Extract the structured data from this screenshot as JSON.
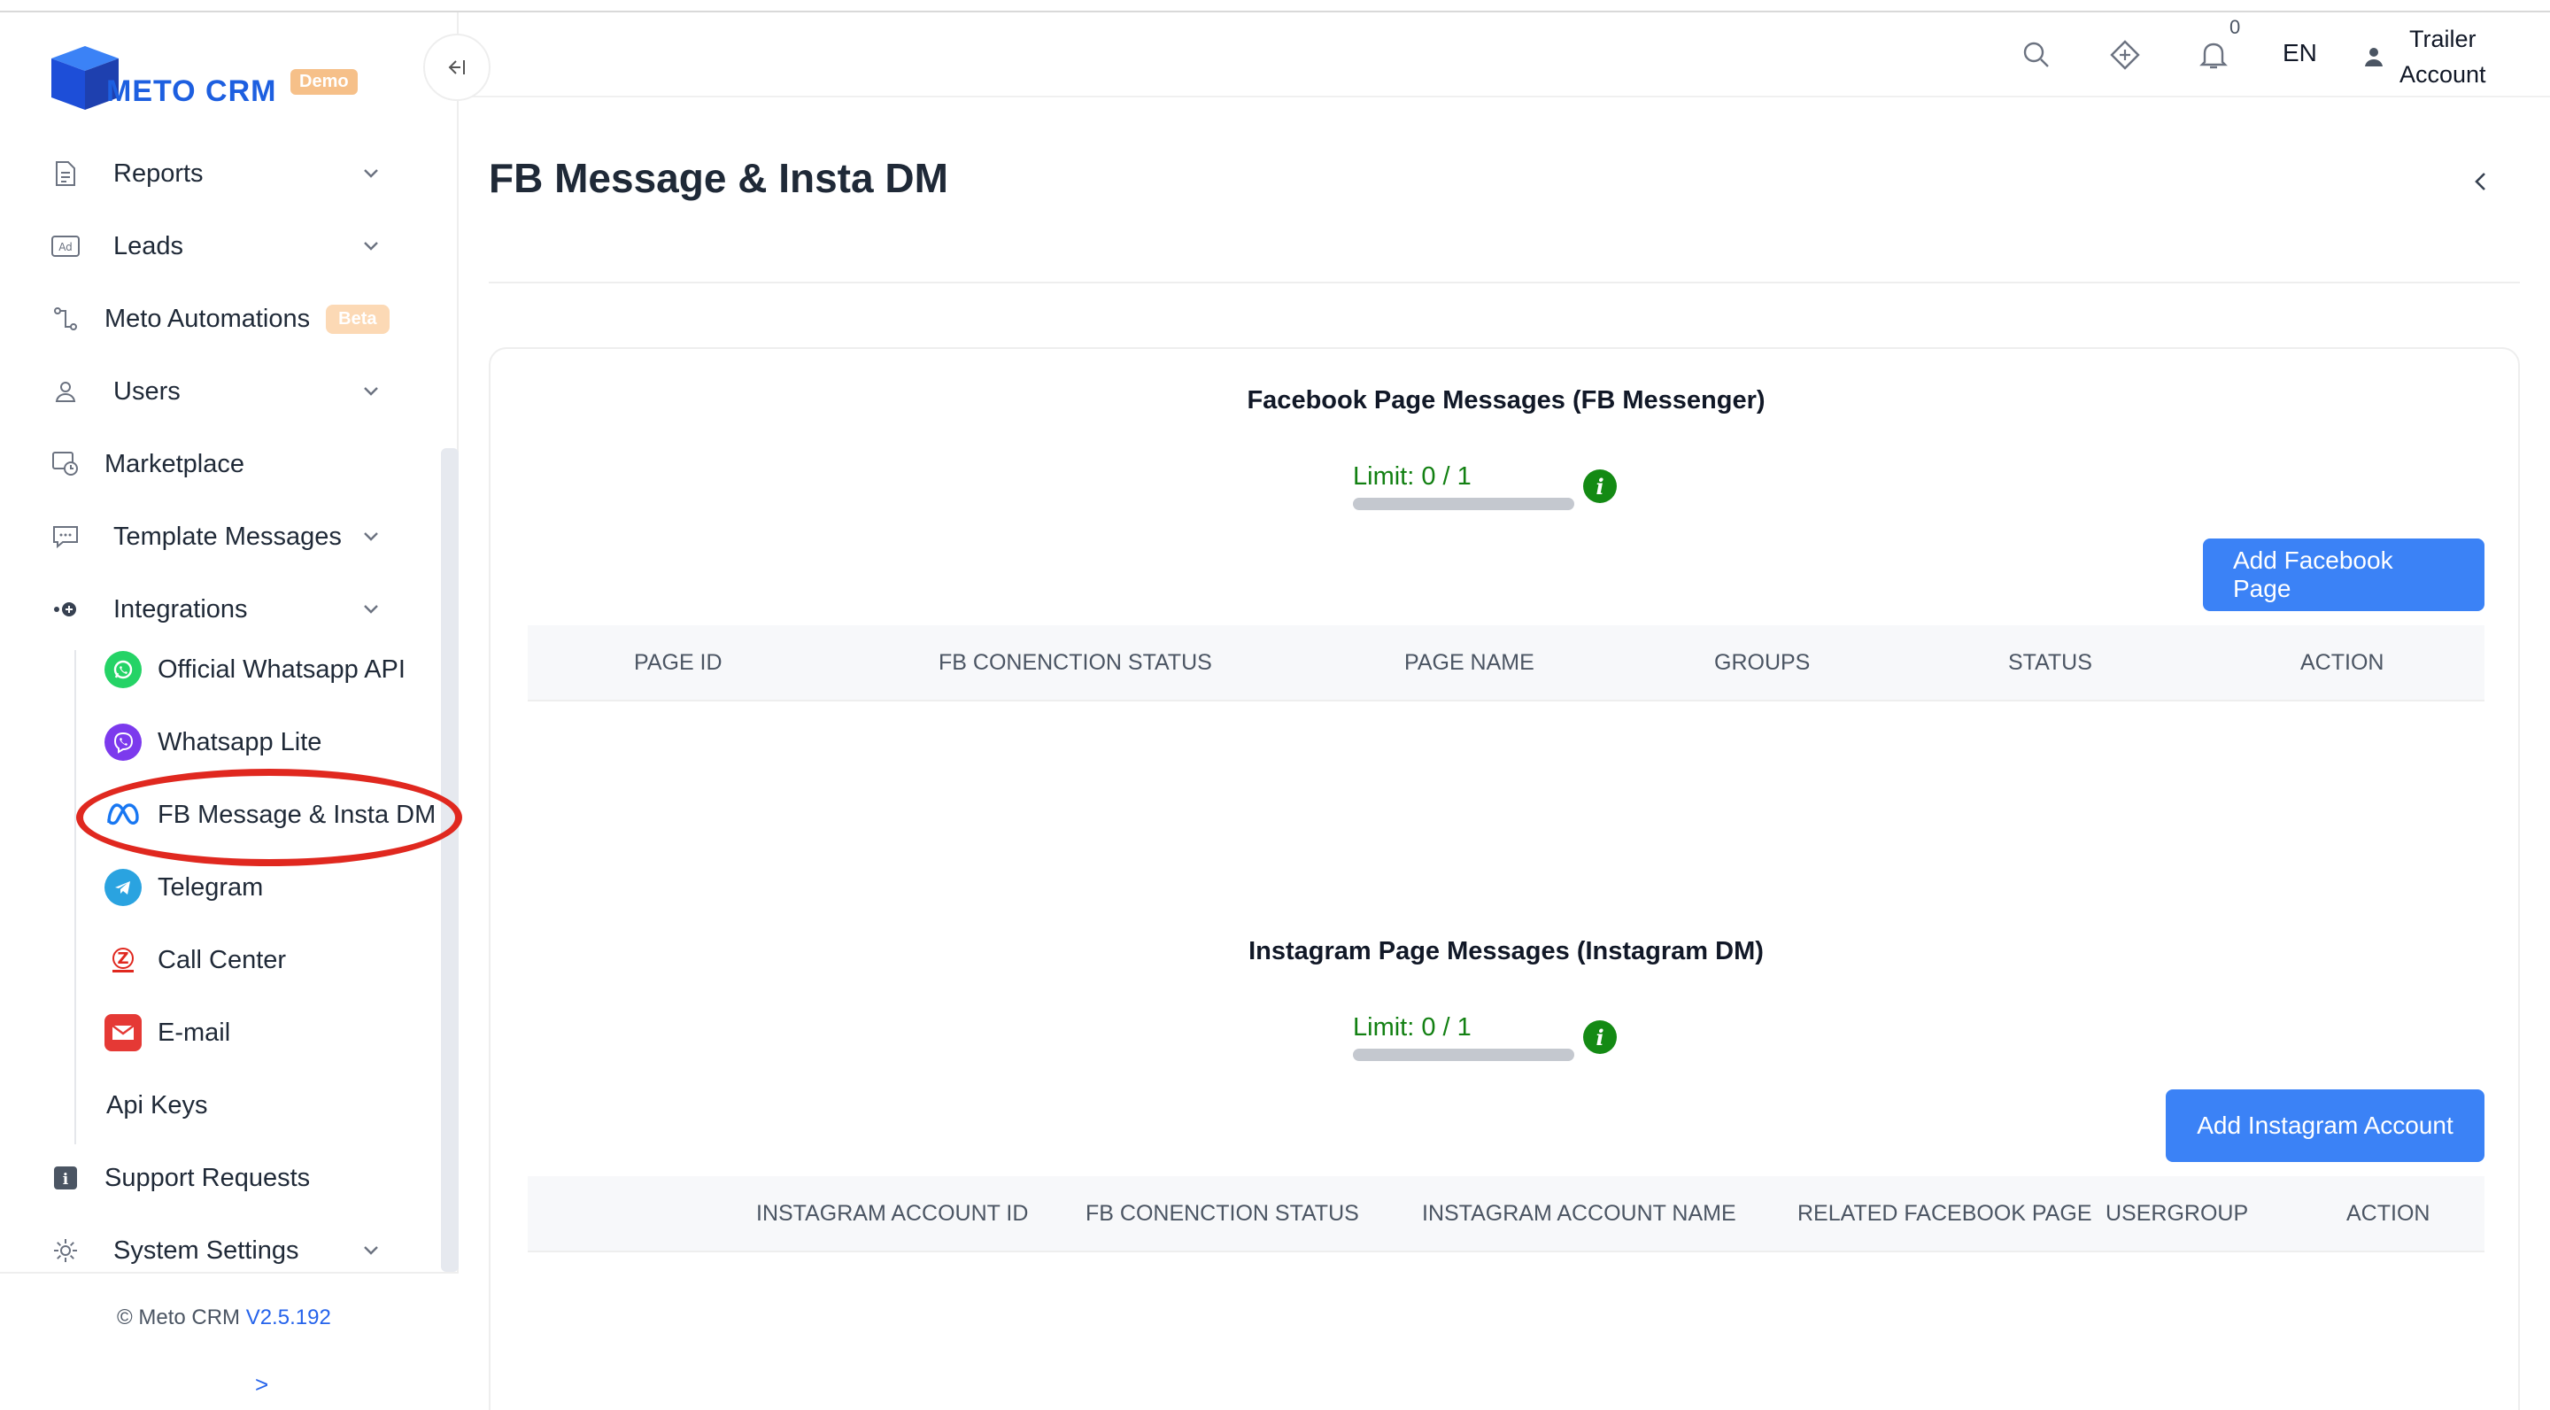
{
  "brand": {
    "name": "METO CRM",
    "badge": "Demo",
    "accent": "#1d5fe0"
  },
  "sidebar": {
    "items": [
      {
        "label": "Reports",
        "icon": "document-icon",
        "has_chevron": true
      },
      {
        "label": "Leads",
        "icon": "ad-icon",
        "has_chevron": true
      },
      {
        "label": "Meto Automations",
        "icon": "automation-icon",
        "badge": "Beta"
      },
      {
        "label": "Users",
        "icon": "user-icon",
        "has_chevron": true
      },
      {
        "label": "Marketplace",
        "icon": "marketplace-icon"
      },
      {
        "label": "Template Messages",
        "icon": "message-icon",
        "has_chevron": true
      },
      {
        "label": "Integrations",
        "icon": "integration-icon",
        "has_chevron": true,
        "expanded": true
      }
    ],
    "integrations": [
      {
        "label": "Official Whatsapp API",
        "icon": "whatsapp-icon"
      },
      {
        "label": "Whatsapp Lite",
        "icon": "viber-icon"
      },
      {
        "label": "FB Message & Insta DM",
        "icon": "meta-icon",
        "highlighted": true
      },
      {
        "label": "Telegram",
        "icon": "telegram-icon"
      },
      {
        "label": "Call Center",
        "icon": "call-center-icon"
      },
      {
        "label": "E-mail",
        "icon": "email-icon"
      }
    ],
    "api_keys": "Api Keys",
    "support": "Support Requests",
    "system_settings": "System Settings",
    "footer": {
      "copyright": "© Meto CRM",
      "version": "V2.5.192",
      "expand": ">"
    }
  },
  "header": {
    "notification_count": "0",
    "language": "EN",
    "account_line1": "Trailer",
    "account_line2": "Account"
  },
  "page": {
    "title": "FB Message & Insta DM"
  },
  "facebook": {
    "title": "Facebook Page Messages (FB Messenger)",
    "limit": "Limit: 0 / 1",
    "button": "Add Facebook Page",
    "columns": [
      "PAGE ID",
      "FB CONENCTION STATUS",
      "PAGE NAME",
      "GROUPS",
      "STATUS",
      "ACTION"
    ]
  },
  "instagram": {
    "title": "Instagram Page Messages (Instagram DM)",
    "limit": "Limit: 0 / 1",
    "button": "Add Instagram Account",
    "columns": [
      "INSTAGRAM ACCOUNT ID",
      "FB CONENCTION STATUS",
      "INSTAGRAM ACCOUNT NAME",
      "RELATED FACEBOOK PAGE",
      "USERGROUP",
      "ACTION"
    ]
  },
  "colors": {
    "primary_button": "#3b82f6",
    "limit_text": "#128012",
    "highlight_ring": "#e0281f"
  }
}
